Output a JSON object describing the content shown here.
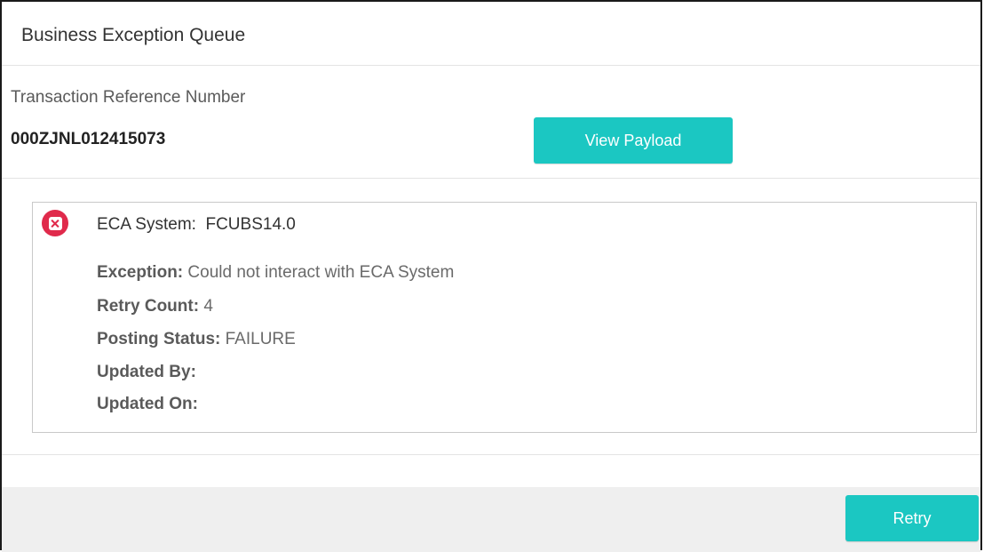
{
  "header": {
    "title": "Business Exception Queue"
  },
  "transaction": {
    "label": "Transaction Reference Number",
    "value": "000ZJNL012415073",
    "view_payload_label": "View Payload"
  },
  "exception_card": {
    "icon": "error-x-icon",
    "title": "ECA System:  FCUBS14.0",
    "details": {
      "exception_key": "Exception:",
      "exception_value": " Could not interact with ECA System",
      "retry_count_key": "Retry Count:",
      "retry_count_value": " 4",
      "posting_status_key": "Posting Status:",
      "posting_status_value": " FAILURE",
      "updated_by_key": "Updated By:",
      "updated_by_value": "",
      "updated_on_key": "Updated On:",
      "updated_on_value": ""
    }
  },
  "footer": {
    "retry_label": "Retry"
  },
  "colors": {
    "accent": "#1bc7c2",
    "error": "#e02a4b",
    "footer_bg": "#efefef"
  }
}
